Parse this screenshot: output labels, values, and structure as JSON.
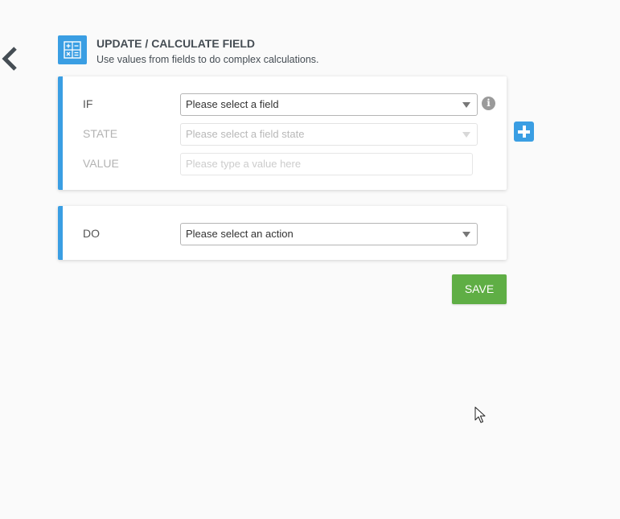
{
  "header": {
    "title": "UPDATE / CALCULATE FIELD",
    "subtitle": "Use values from fields to do complex calculations.",
    "icon": "calculator-icon"
  },
  "navigation": {
    "back_icon": "chevron-left-icon"
  },
  "condition": {
    "if_label": "IF",
    "if_select_value": "Please select a field",
    "state_label": "STATE",
    "state_select_value": "Please select a field state",
    "value_label": "VALUE",
    "value_placeholder": "Please type a value here",
    "info_icon": "info-icon",
    "add_icon": "plus-icon"
  },
  "action": {
    "do_label": "DO",
    "do_select_value": "Please select an action"
  },
  "buttons": {
    "save_label": "SAVE"
  },
  "colors": {
    "accent": "#3a9ee3",
    "save": "#5fae45",
    "background": "#fafafa"
  }
}
